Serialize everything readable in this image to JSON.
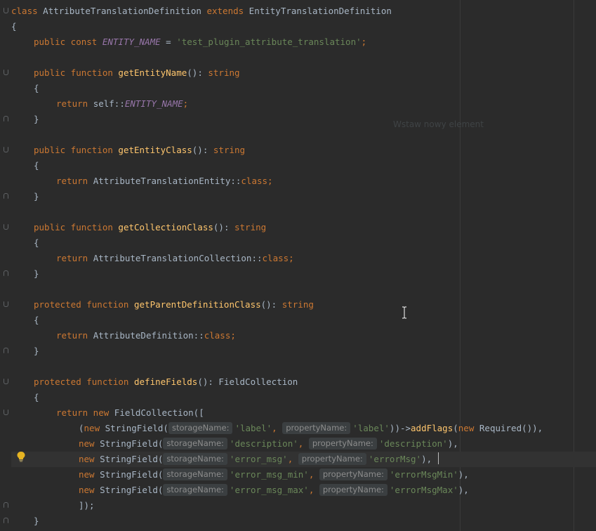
{
  "editor": {
    "ghost_text": "Wstaw nowy element",
    "icons": {
      "fold": "fold-marker-icon",
      "bulb": "intention-bulb-icon",
      "cursor": "text-cursor-icon"
    },
    "colors": {
      "background": "#2b2b2b",
      "keyword": "#cc7832",
      "function": "#ffc66d",
      "constant": "#9876aa",
      "string": "#6a8759",
      "text": "#a9b7c6"
    },
    "lines": {
      "l1": {
        "k1": "class",
        "t1": " AttributeTranslationDefinition ",
        "k2": "extends",
        "t2": " EntityTranslationDefinition"
      },
      "l2": {
        "t1": "{"
      },
      "l3": {
        "k1": "public const ",
        "c1": "ENTITY_NAME",
        "t1": " = ",
        "s1": "'test_plugin_attribute_translation'",
        "t2": ";"
      },
      "l5": {
        "k1": "public function ",
        "f1": "getEntityName",
        "t1": "(): ",
        "k2": "string"
      },
      "l6": {
        "t1": "{"
      },
      "l7": {
        "k1": "return ",
        "t1": "self::",
        "c1": "ENTITY_NAME",
        "t2": ";"
      },
      "l8": {
        "t1": "}"
      },
      "l10": {
        "k1": "public function ",
        "f1": "getEntityClass",
        "t1": "(): ",
        "k2": "string"
      },
      "l11": {
        "t1": "{"
      },
      "l12": {
        "k1": "return ",
        "t1": "AttributeTranslationEntity::",
        "k2": "class",
        "t2": ";"
      },
      "l13": {
        "t1": "}"
      },
      "l15": {
        "k1": "public function ",
        "f1": "getCollectionClass",
        "t1": "(): ",
        "k2": "string"
      },
      "l16": {
        "t1": "{"
      },
      "l17": {
        "k1": "return ",
        "t1": "AttributeTranslationCollection::",
        "k2": "class",
        "t2": ";"
      },
      "l18": {
        "t1": "}"
      },
      "l20": {
        "k1": "protected function ",
        "f1": "getParentDefinitionClass",
        "t1": "(): ",
        "k2": "string"
      },
      "l21": {
        "t1": "{"
      },
      "l22": {
        "k1": "return ",
        "t1": "AttributeDefinition::",
        "k2": "class",
        "t2": ";"
      },
      "l23": {
        "t1": "}"
      },
      "l25": {
        "k1": "protected function ",
        "f1": "defineFields",
        "t1": "(): FieldCollection"
      },
      "l26": {
        "t1": "{"
      },
      "l27": {
        "k1": "return new ",
        "t1": "FieldCollection(["
      },
      "l28": {
        "t0": "(",
        "k1": "new ",
        "t1": "StringField(",
        "h1": "storageName:",
        "s1": "'label'",
        "t2": ", ",
        "h2": "propertyName:",
        "s2": "'label'",
        "t3": "))->",
        "f1": "addFlags",
        "t4": "(",
        "k2": "new ",
        "t5": "Required()),"
      },
      "l29": {
        "k1": "new ",
        "t1": "StringField(",
        "h1": "storageName:",
        "s1": "'description'",
        "t2": ", ",
        "h2": "propertyName:",
        "s2": "'description'",
        "t3": "),"
      },
      "l30": {
        "k1": "new ",
        "t1": "StringField(",
        "h1": "storageName:",
        "s1": "'error_msg'",
        "t2": ", ",
        "h2": "propertyName:",
        "s2": "'errorMsg'",
        "t3": "),"
      },
      "l31": {
        "k1": "new ",
        "t1": "StringField(",
        "h1": "storageName:",
        "s1": "'error_msg_min'",
        "t2": ", ",
        "h2": "propertyName:",
        "s2": "'errorMsgMin'",
        "t3": "),"
      },
      "l32": {
        "k1": "new ",
        "t1": "StringField(",
        "h1": "storageName:",
        "s1": "'error_msg_max'",
        "t2": ", ",
        "h2": "propertyName:",
        "s2": "'errorMsgMax'",
        "t3": "),"
      },
      "l33": {
        "t1": "]);"
      },
      "l34": {
        "t1": "}"
      }
    }
  }
}
